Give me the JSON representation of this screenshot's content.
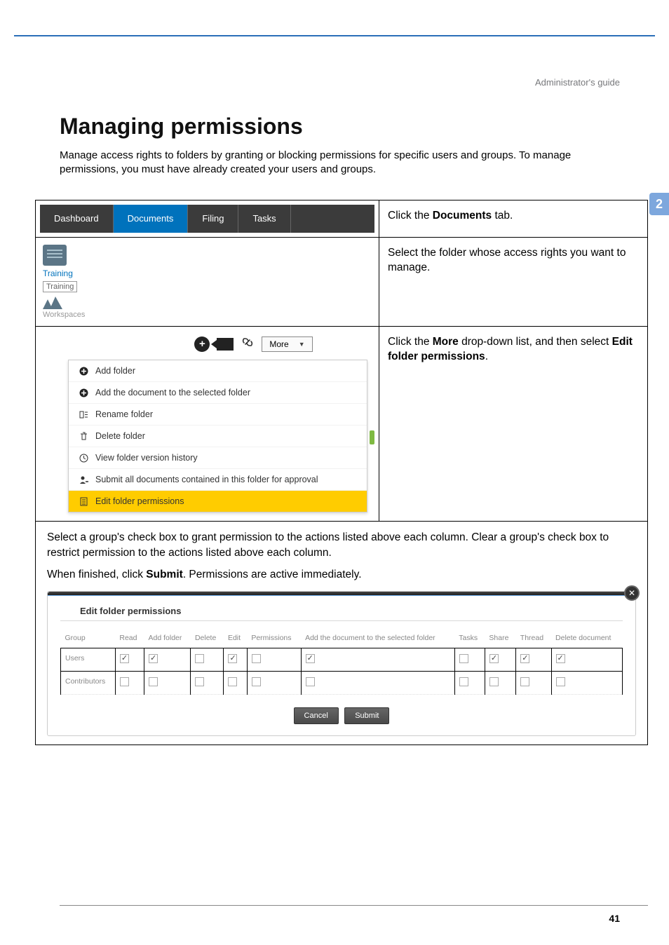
{
  "header": {
    "guide_label": "Administrator's guide"
  },
  "page": {
    "title": "Managing permissions",
    "intro": "Manage access rights to folders by granting or blocking permissions for specific users and groups. To manage permissions, you must have already created your users and groups.",
    "chapter": "2",
    "number": "41"
  },
  "row1": {
    "tabs": [
      "Dashboard",
      "Documents",
      "Filing",
      "Tasks"
    ],
    "active_index": 1,
    "instruction_pre": "Click the ",
    "instruction_bold": "Documents",
    "instruction_post": " tab."
  },
  "row2": {
    "training_label": "Training",
    "training_box": "Training",
    "workspaces_label": "Workspaces",
    "instruction": "Select the folder whose access rights you want to manage."
  },
  "row3": {
    "more_label": "More",
    "menu": [
      {
        "icon": "⊕",
        "label": "Add folder"
      },
      {
        "icon": "⊕",
        "label": "Add the document to the selected folder"
      },
      {
        "icon": "⋮≡",
        "label": "Rename folder"
      },
      {
        "icon": "🗑",
        "label": "Delete folder"
      },
      {
        "icon": "◴",
        "label": "View folder version history"
      },
      {
        "icon": "👤",
        "label": "Submit all documents contained in this folder for approval"
      },
      {
        "icon": "📋",
        "label": "Edit folder permissions"
      }
    ],
    "instruction_pre": "Click the ",
    "instruction_b1": "More",
    "instruction_mid": " drop-down list, and then select ",
    "instruction_b2": "Edit folder permissions",
    "instruction_post": "."
  },
  "row4": {
    "text1": "Select a group's check box to grant permission to the actions listed above each column. Clear a group's check box to restrict permission to the actions listed above each column.",
    "text2_pre": "When finished, click ",
    "text2_bold": "Submit",
    "text2_post": ". Permissions are active immediately.",
    "panel_title": "Edit folder permissions",
    "columns": [
      "Group",
      "Read",
      "Add folder",
      "Delete",
      "Edit",
      "Permissions",
      "Add the document to the selected folder",
      "Tasks",
      "Share",
      "Thread",
      "Delete document"
    ],
    "rows": [
      {
        "name": "Users",
        "vals": [
          true,
          true,
          false,
          true,
          false,
          true,
          false,
          true,
          true,
          true
        ]
      },
      {
        "name": "Contributors",
        "vals": [
          false,
          false,
          false,
          false,
          false,
          false,
          false,
          false,
          false,
          false
        ]
      }
    ],
    "cancel": "Cancel",
    "submit": "Submit"
  }
}
